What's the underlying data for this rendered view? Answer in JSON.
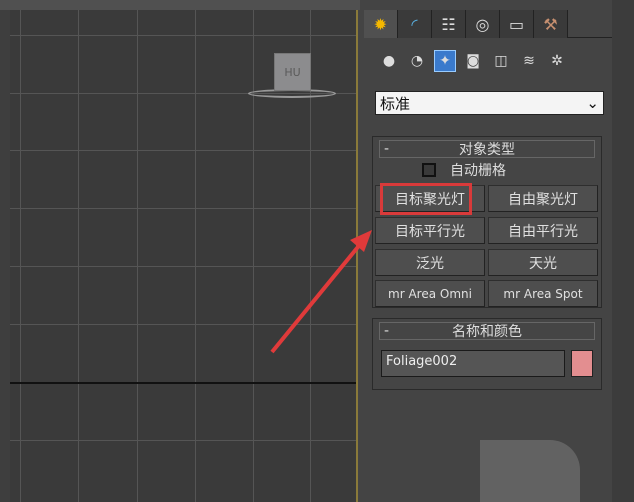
{
  "viewport": {
    "object_label": "HU"
  },
  "command_panel": {
    "tabs": [
      {
        "name": "create",
        "icon": "✹"
      },
      {
        "name": "modify",
        "icon": "◜"
      },
      {
        "name": "hierarchy",
        "icon": "☷"
      },
      {
        "name": "motion",
        "icon": "◎"
      },
      {
        "name": "display",
        "icon": "▭"
      },
      {
        "name": "utilities",
        "icon": "⚒"
      }
    ],
    "category_icons": [
      {
        "name": "geometry",
        "icon": "●"
      },
      {
        "name": "shapes",
        "icon": "◔"
      },
      {
        "name": "lights",
        "icon": "✦"
      },
      {
        "name": "cameras",
        "icon": "◙"
      },
      {
        "name": "helpers",
        "icon": "◫"
      },
      {
        "name": "space-warps",
        "icon": "≋"
      },
      {
        "name": "systems",
        "icon": "✲"
      }
    ],
    "dropdown": {
      "value": "标准",
      "arrow": "⌄"
    },
    "object_type": {
      "title": "对象类型",
      "collapse": "-",
      "autogrid_label": "自动栅格",
      "buttons": [
        "目标聚光灯",
        "自由聚光灯",
        "目标平行光",
        "自由平行光",
        "泛光",
        "天光",
        "mr Area Omni",
        "mr Area Spot"
      ]
    },
    "name_color": {
      "title": "名称和颜色",
      "collapse": "-",
      "name_value": "Foliage002",
      "color": "#e38e90"
    }
  },
  "annotation": {
    "highlight_color": "#d93a3a"
  }
}
